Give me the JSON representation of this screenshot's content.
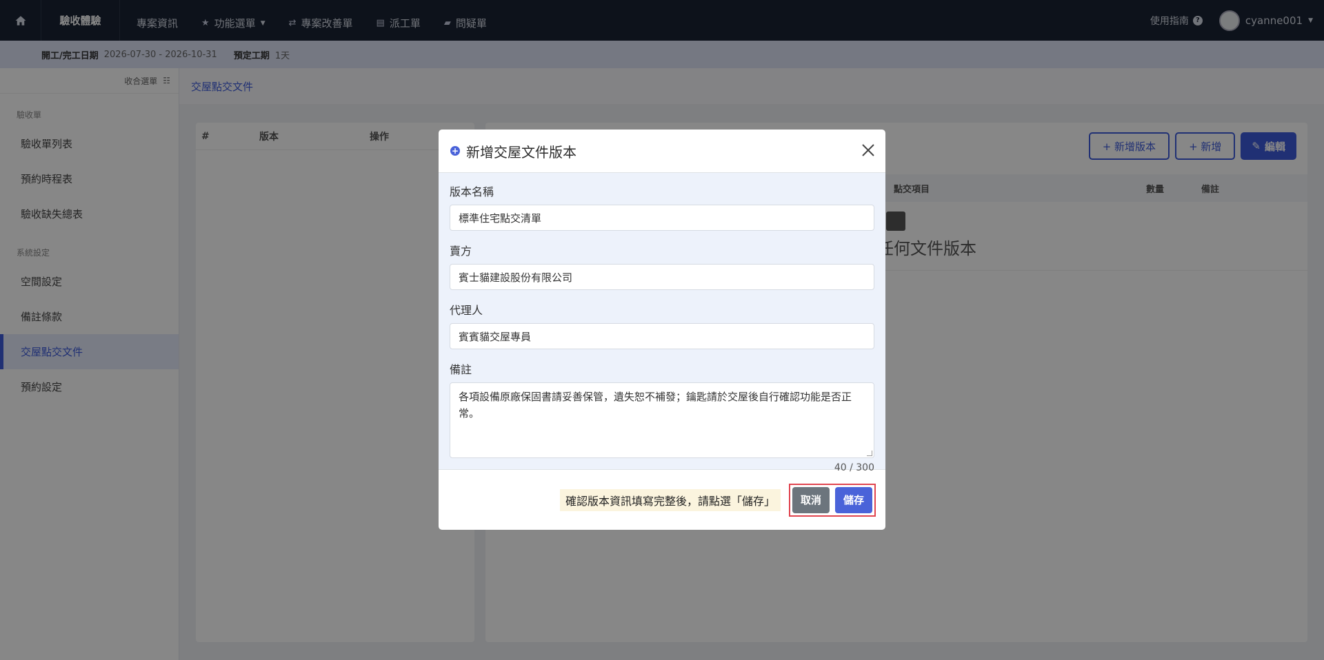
{
  "topnav": {
    "brand": "驗收體驗",
    "links": [
      {
        "label": "專案資訊",
        "icon": ""
      },
      {
        "label": "功能選單",
        "icon": "★"
      },
      {
        "label": "專案改善單",
        "icon": "⇄"
      },
      {
        "label": "派工單",
        "icon": "▤"
      },
      {
        "label": "問疑單",
        "icon": "▰"
      }
    ],
    "guide": "使用指南",
    "user": "cyanne001"
  },
  "infobar": {
    "k1": "開工/完工日期",
    "v1": "2026-07-30 - 2026-10-31",
    "k2": "預定工期",
    "v2": "1天"
  },
  "sidebar": {
    "collapse_label": "收合選單",
    "section1": "驗收單",
    "items1": [
      "驗收單列表",
      "預約時程表",
      "驗收缺失總表"
    ],
    "section2": "系統設定",
    "items2": [
      "空間設定",
      "備註條款",
      "交屋點交文件",
      "預約設定"
    ]
  },
  "breadcrumb": "交屋點交文件",
  "left_table": {
    "headers": [
      "#",
      "版本",
      "操作"
    ]
  },
  "right_panel": {
    "buttons": {
      "add_version": "+ 新增版本",
      "add": "+ 新增",
      "edit": "編輯"
    },
    "headers": [
      "點交項目",
      "數量",
      "備註"
    ],
    "empty_text": "任何文件版本"
  },
  "modal": {
    "title": "新增交屋文件版本",
    "fields": [
      {
        "label": "版本名稱",
        "value": "標準住宅點交清單"
      },
      {
        "label": "賣方",
        "value": "賓士貓建設股份有限公司"
      },
      {
        "label": "代理人",
        "value": "賓賓貓交屋專員"
      }
    ],
    "note_label": "備註",
    "note_value": "各項設備原廠保固書請妥善保管，遺失恕不補發；鑰匙請於交屋後自行確認功能是否正常。",
    "counter": "40 / 300",
    "hint": "確認版本資訊填寫完整後，請點選「儲存」",
    "cancel": "取消",
    "save": "儲存"
  },
  "colors": {
    "primary": "#3e5bdb",
    "nav": "#1a2333",
    "highlight": "#e0434e"
  }
}
